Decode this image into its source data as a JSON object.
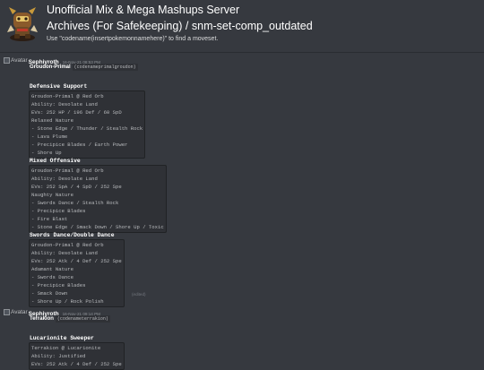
{
  "header": {
    "server_name": "Unofficial Mix & Mega Mashups Server",
    "channel": "Archives (For Safekeeping) / snm-set-comp_outdated",
    "topic": "Use \"codename(insertpokemonnamehere)\" to find a moveset."
  },
  "messages": [
    {
      "avatar_alt": "Avatar",
      "author": "Sephiyroth",
      "timestamp": "16-Nov-21 08:53 PM",
      "pokemon": "Groudon-Primal",
      "codename": "(codenameprimalgroudon)",
      "sets": [
        {
          "title": "Defensive Support",
          "lines": [
            "Groudon-Primal @ Red Orb",
            "Ability: Desolate Land",
            "EVs: 252 HP / 196 Def / 60 SpD",
            "Relaxed Nature",
            "- Stone Edge / Thunder / Stealth Rock",
            "- Lava Plume",
            "- Precipice Blades / Earth Power",
            "- Shore Up"
          ]
        },
        {
          "title": "Mixed Offensive",
          "lines": [
            "Groudon-Primal @ Red Orb",
            "Ability: Desolate Land",
            "EVs: 252 SpA / 4 SpD / 252 Spe",
            "Naughty Nature",
            "- Swords Dance / Stealth Rock",
            "- Precipice Blades",
            "- Fire Blast",
            "- Stone Edge / Smack Down / Shore Up / Toxic"
          ]
        },
        {
          "title": "Swords Dance/Double Dance",
          "lines": [
            "Groudon-Primal @ Red Orb",
            "Ability: Desolate Land",
            "EVs: 252 Atk / 4 Def / 252 Spe",
            "Adamant Nature",
            "- Swords Dance",
            "- Precipice Blades",
            "- Smack Down",
            "- Shore Up / Rock Polish"
          ],
          "edited": "(edited)"
        }
      ]
    },
    {
      "avatar_alt": "Avatar",
      "author": "Sephiyroth",
      "timestamp": "16-Nov-21 09:14 PM",
      "pokemon": "Terrakion",
      "codename": "(codenameterrakion)",
      "sets": [
        {
          "title": "Lucarionite Sweeper",
          "lines": [
            "Terrakion @ Lucarionite",
            "Ability: Justified",
            "EVs: 252 Atk / 4 Def / 252 Spe"
          ]
        }
      ]
    }
  ]
}
